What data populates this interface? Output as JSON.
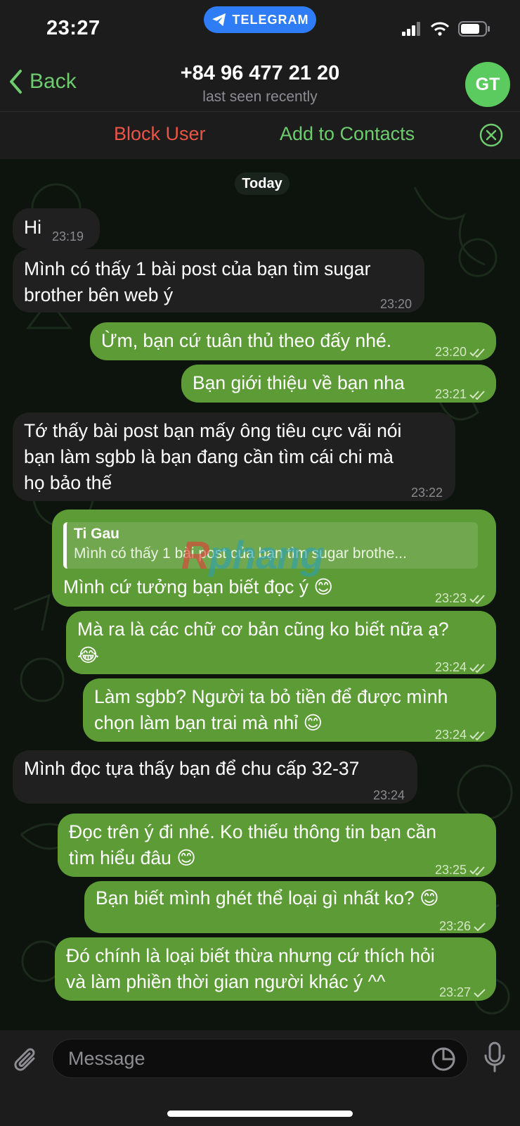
{
  "status": {
    "time": "23:27",
    "app_pill": "TELEGRAM"
  },
  "header": {
    "back_label": "Back",
    "contact_name": "+84 96 477 21 20",
    "last_seen": "last seen recently",
    "avatar_initials": "GT",
    "avatar_color": "#5ccb5f"
  },
  "actions": {
    "block": "Block User",
    "add": "Add to Contacts"
  },
  "chat": {
    "date_chip": "Today",
    "watermark": {
      "r": "R",
      "rest": "phang"
    },
    "messages": [
      {
        "dir": "in",
        "lines": [
          "Hi"
        ],
        "time": "23:19"
      },
      {
        "dir": "in",
        "lines": [
          "Mình có thấy 1 bài post của bạn tìm sugar",
          "brother bên web ý"
        ],
        "time": "23:20"
      },
      {
        "dir": "out",
        "lines": [
          "Ừm, bạn cứ tuân thủ theo đấy nhé."
        ],
        "time": "23:20",
        "status": "read"
      },
      {
        "dir": "out",
        "lines": [
          "Bạn giới thiệu về bạn nha"
        ],
        "time": "23:21",
        "status": "read"
      },
      {
        "dir": "in",
        "lines": [
          "Tớ thấy bài post bạn mấy ông tiêu cực vãi nói",
          "bạn làm sgbb là bạn đang cần tìm cái chi mà",
          "họ bảo thế"
        ],
        "time": "23:22"
      },
      {
        "dir": "out",
        "reply_name": "Ti Gau",
        "reply_text": "Mình có thấy 1 bài post của bạn tìm sugar brothe...",
        "lines": [
          "Mình cứ tưởng bạn biết đọc ý 😊"
        ],
        "time": "23:23",
        "status": "read"
      },
      {
        "dir": "out",
        "lines": [
          "Mà ra là các chữ cơ bản cũng ko biết nữa ạ?",
          "😂"
        ],
        "time": "23:24",
        "status": "read"
      },
      {
        "dir": "out",
        "lines": [
          "Làm sgbb? Người ta bỏ tiền để được mình",
          "chọn làm bạn trai mà nhỉ 😊"
        ],
        "time": "23:24",
        "status": "read"
      },
      {
        "dir": "in",
        "lines": [
          "Mình đọc tựa thấy bạn để chu cấp 32-37"
        ],
        "time": "23:24"
      },
      {
        "dir": "out",
        "lines": [
          "Đọc trên ý đi nhé. Ko thiếu thông tin bạn cần",
          "tìm hiểu đâu 😊"
        ],
        "time": "23:25",
        "status": "read"
      },
      {
        "dir": "out",
        "lines": [
          "Bạn biết mình ghét thể loại gì nhất ko? 😊"
        ],
        "time": "23:26",
        "status": "sent"
      },
      {
        "dir": "out",
        "lines": [
          "Đó chính là loại biết thừa nhưng cứ thích hỏi",
          "và làm phiền thời gian người khác ý ^^"
        ],
        "time": "23:27",
        "status": "sent"
      }
    ]
  },
  "composer": {
    "placeholder": "Message"
  },
  "icons": {
    "telegram": "telegram-plane-icon",
    "back": "chevron-left-icon",
    "close": "close-circle-icon",
    "attach": "paperclip-icon",
    "sticker": "sticker-icon",
    "mic": "microphone-icon",
    "read": "double-check-icon",
    "sent": "single-check-icon"
  }
}
